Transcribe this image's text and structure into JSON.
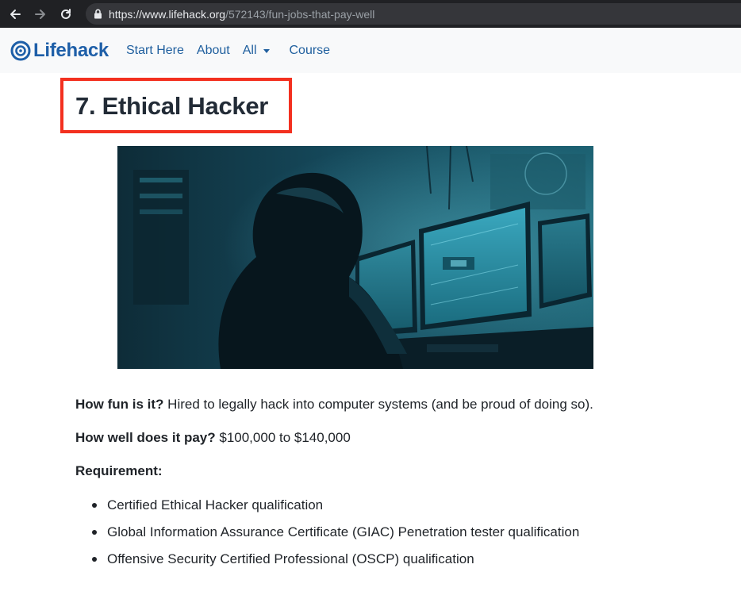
{
  "browser": {
    "url_host": "https://www.lifehack.org",
    "url_path": "/572143/fun-jobs-that-pay-well",
    "icons": [
      "back-icon",
      "forward-icon",
      "reload-icon",
      "lock-icon"
    ]
  },
  "header": {
    "logo_text": "Lifehack",
    "nav": [
      {
        "label": "Start Here"
      },
      {
        "label": "About"
      },
      {
        "label": "All"
      },
      {
        "label": "Course"
      }
    ],
    "link_color": "#1f5f9e"
  },
  "article": {
    "heading": "7. Ethical Hacker",
    "highlight_color": "#f3301f",
    "image_subject": "hooded hacker at computer monitors",
    "fun_label": "How fun is it?",
    "fun_text": " Hired to legally hack into computer systems (and be proud of doing so).",
    "pay_label": "How well does it pay?",
    "pay_text": " $100,000 to $140,000",
    "requirement_label": "Requirement:",
    "requirements": [
      "Certified Ethical Hacker qualification",
      "Global Information Assurance Certificate (GIAC) Penetration tester qualification",
      "Offensive Security Certified Professional (OSCP) qualification"
    ]
  }
}
